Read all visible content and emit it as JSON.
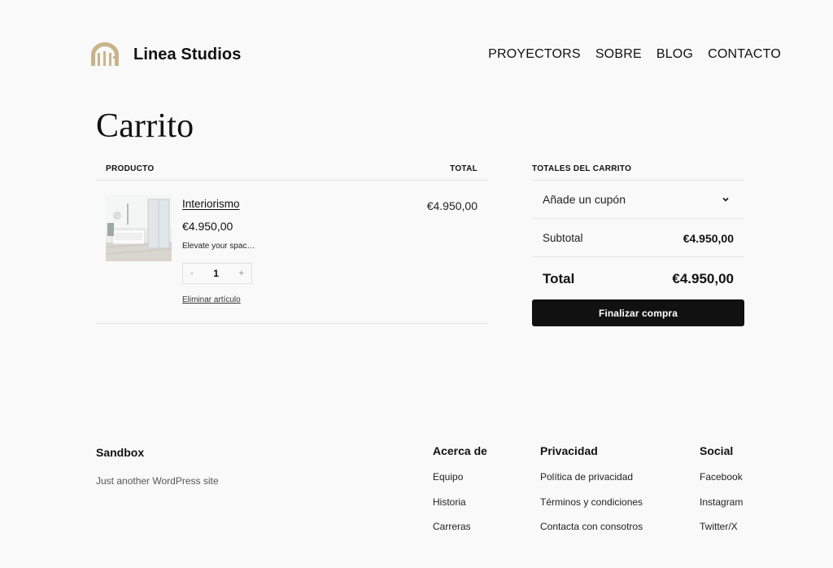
{
  "header": {
    "brand": "Linea Studios",
    "logo_icon": "arch-logo-icon",
    "nav": [
      "PROYECTORS",
      "SOBRE",
      "BLOG",
      "CONTACTO"
    ]
  },
  "page": {
    "title": "Carrito"
  },
  "cart": {
    "columns": {
      "product": "PRODUCTO",
      "total": "TOTAL"
    },
    "item": {
      "name": "Interiorismo",
      "price": "€4.950,00",
      "description": "Elevate your spac…",
      "quantity": "1",
      "decrement": "-",
      "increment": "+",
      "remove_label": "Eliminar artículo",
      "line_total": "€4.950,00"
    }
  },
  "totals": {
    "heading": "TOTALES DEL CARRITO",
    "coupon_label": "Añade un cupón",
    "subtotal_label": "Subtotal",
    "subtotal_value": "€4.950,00",
    "total_label": "Total",
    "total_value": "€4.950,00",
    "checkout_label": "Finalizar compra"
  },
  "footer": {
    "site_name": "Sandbox",
    "tagline": "Just another WordPress site",
    "columns": [
      {
        "heading": "Acerca de",
        "links": [
          "Equipo",
          "Historia",
          "Carreras"
        ]
      },
      {
        "heading": "Privacidad",
        "links": [
          "Política de privacidad",
          "Términos y condiciones",
          "Contacta con consotros"
        ]
      },
      {
        "heading": "Social",
        "links": [
          "Facebook",
          "Instagram",
          "Twitter/X"
        ]
      }
    ]
  },
  "colors": {
    "background": "#f9f9f9",
    "text": "#111111",
    "button": "#111111",
    "divider": "#e4e4e4",
    "logo": "#c9b48a"
  }
}
